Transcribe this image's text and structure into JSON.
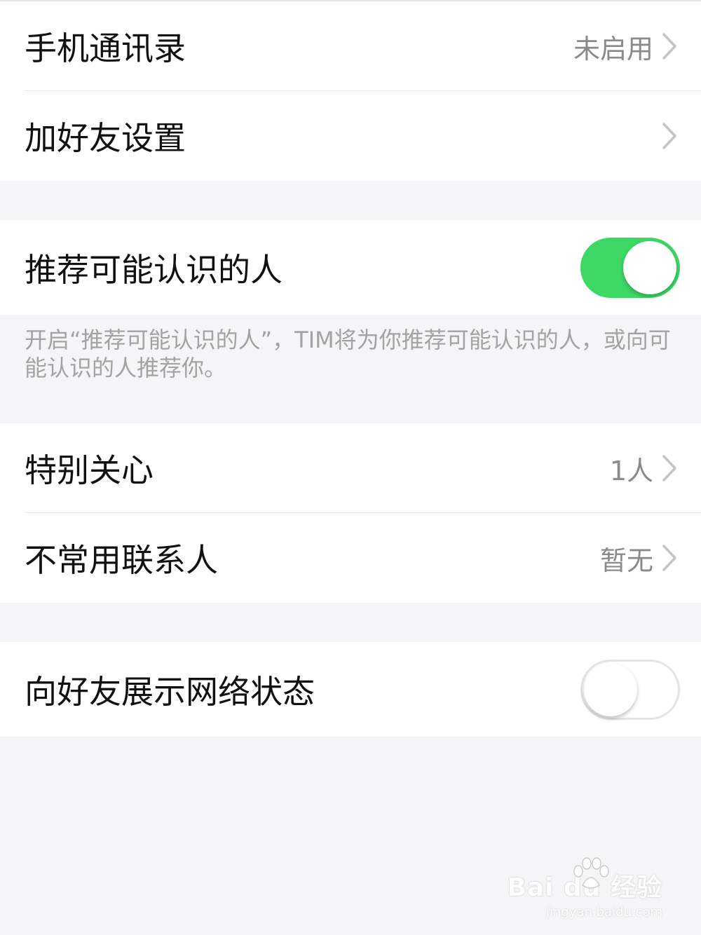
{
  "contacts_group": {
    "phone_contacts": {
      "label": "手机通讯录",
      "value": "未启用"
    },
    "add_friend_settings": {
      "label": "加好友设置"
    }
  },
  "recommend": {
    "label": "推荐可能认识的人",
    "toggle_on": true,
    "note": "开启“推荐可能认识的人”，TIM将为你推荐可能认识的人，或向可能认识的人推荐你。"
  },
  "care_group": {
    "special_care": {
      "label": "特别关心",
      "value": "1人"
    },
    "infrequent_contacts": {
      "label": "不常用联系人",
      "value": "暂无"
    }
  },
  "network_status": {
    "label": "向好友展示网络状态",
    "toggle_on": false
  },
  "watermark": {
    "main": "Bai du 经验",
    "url": "jingyan.baidu.com"
  },
  "colors": {
    "toggle_on": "#3dd765",
    "background": "#f4f5f7"
  },
  "icons": {
    "chevron": "chevron-right-icon",
    "paw": "baidu-paw-icon"
  }
}
